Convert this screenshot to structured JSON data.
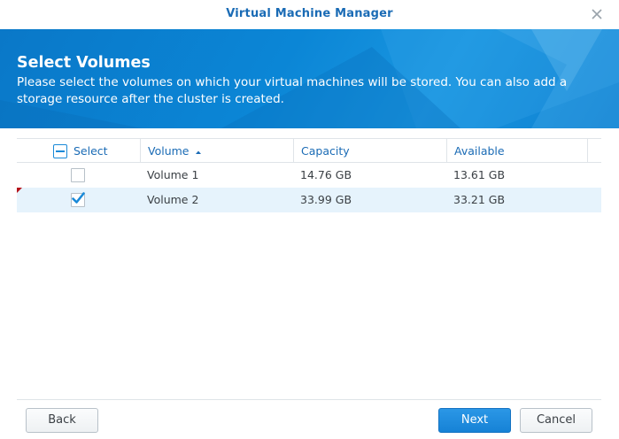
{
  "window": {
    "title": "Virtual Machine Manager"
  },
  "banner": {
    "heading": "Select Volumes",
    "description": "Please select the volumes on which your virtual machines will be stored. You can also add a storage resource after the cluster is created."
  },
  "table": {
    "columns": {
      "select": "Select",
      "volume": "Volume",
      "capacity": "Capacity",
      "available": "Available"
    },
    "sort": {
      "column": "Volume",
      "direction": "ascending"
    },
    "rows": [
      {
        "volume": "Volume 1",
        "capacity": "14.76 GB",
        "available": "13.61 GB",
        "checked": false
      },
      {
        "volume": "Volume 2",
        "capacity": "33.99 GB",
        "available": "33.21 GB",
        "checked": true
      }
    ]
  },
  "buttons": {
    "back": "Back",
    "next": "Next",
    "cancel": "Cancel"
  },
  "colors": {
    "accent": "#1a6bb5",
    "banner": "#0b86d6",
    "selected_row": "#e6f3fc",
    "primary_button": "#1682d6"
  }
}
